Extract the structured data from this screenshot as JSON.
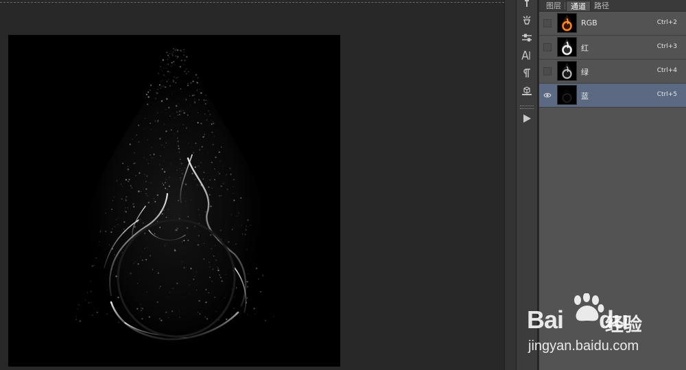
{
  "panel": {
    "tabs": [
      {
        "label": "图层"
      },
      {
        "label": "通道"
      },
      {
        "label": "路径"
      }
    ],
    "active_tab": "通道",
    "channels": [
      {
        "name": "RGB",
        "shortcut": "Ctrl+2",
        "visible": false,
        "selected": false
      },
      {
        "name": "红",
        "shortcut": "Ctrl+3",
        "visible": false,
        "selected": false
      },
      {
        "name": "绿",
        "shortcut": "Ctrl+4",
        "visible": false,
        "selected": false
      },
      {
        "name": "蓝",
        "shortcut": "Ctrl+5",
        "visible": true,
        "selected": true
      }
    ]
  },
  "toolbar": {
    "tools": [
      "history-brush-icon",
      "brush-preset-icon",
      "adjustment-sliders-icon",
      "character-icon",
      "paragraph-icon",
      "3d-cube-icon",
      "play-action-icon"
    ]
  },
  "watermark": {
    "logo": "Bai",
    "logo_tail": "du",
    "cn": "经验",
    "url": "jingyan.baidu.com"
  },
  "colors": {
    "workspace": "#282828",
    "panel": "#535353",
    "selected_row": "#5b6a82"
  }
}
